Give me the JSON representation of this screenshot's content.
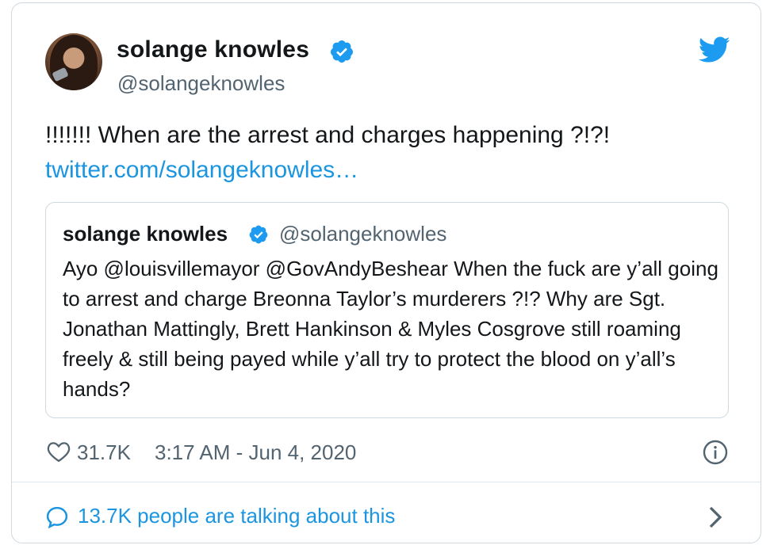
{
  "tweet": {
    "display_name": "solange knowles",
    "handle": "@solangeknowles",
    "text": "!!!!!!! When are the arrest and charges happening ?!?!",
    "link": "twitter.com/solangeknowles…",
    "likes": "31.7K",
    "timestamp": "3:17 AM - Jun 4, 2020",
    "talking": "13.7K people are talking about this"
  },
  "quoted_tweet": {
    "display_name": "solange knowles",
    "handle": "@solangeknowles",
    "text": "Ayo @louisvillemayor @GovAndyBeshear When the fuck are y’all going to arrest and charge Breonna Taylor’s murderers ?!? Why are Sgt. Jonathan Mattingly, Brett Hankinson & Myles Cosgrove still roaming freely & still being payed while y’all try to protect the blood on y’all’s hands?"
  },
  "icons": {
    "verified": "verified-badge-icon",
    "bird": "twitter-bird-icon",
    "heart": "heart-icon",
    "info": "info-icon",
    "bubble": "speech-bubble-icon",
    "chevron": "chevron-right-icon"
  },
  "colors": {
    "accent": "#1b95e0",
    "verified": "#1d9bf0",
    "muted": "#536471",
    "border": "#cfd9de"
  }
}
